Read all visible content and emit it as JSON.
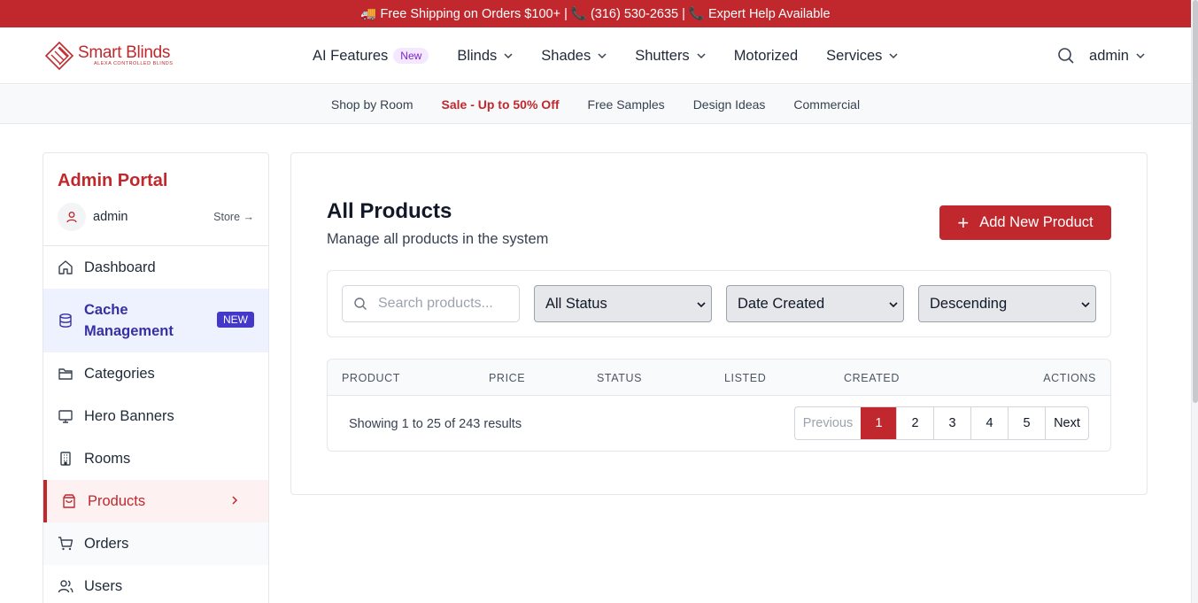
{
  "promo": {
    "text": "🚚 Free Shipping on Orders $100+ | 📞 (316) 530-2635 | 📞 Expert Help Available"
  },
  "logo": {
    "title": "Smart Blinds",
    "subtitle": "ALEXA CONTROLLED BLINDS"
  },
  "nav": {
    "items": [
      {
        "label": "AI Features",
        "badge": "New"
      },
      {
        "label": "Blinds"
      },
      {
        "label": "Shades"
      },
      {
        "label": "Shutters"
      },
      {
        "label": "Motorized"
      },
      {
        "label": "Services"
      }
    ],
    "user": "admin"
  },
  "subnav": [
    "Shop by Room",
    "Sale - Up to 50% Off",
    "Free Samples",
    "Design Ideas",
    "Commercial"
  ],
  "sidebar": {
    "title": "Admin Portal",
    "user": "admin",
    "store_link": "Store →",
    "items": [
      {
        "label": "Dashboard",
        "icon": "home-icon"
      },
      {
        "label": "Cache Management",
        "icon": "database-icon",
        "badge": "NEW"
      },
      {
        "label": "Categories",
        "icon": "folder-icon"
      },
      {
        "label": "Hero Banners",
        "icon": "monitor-icon"
      },
      {
        "label": "Rooms",
        "icon": "building-icon"
      },
      {
        "label": "Products",
        "icon": "shopping-bag-icon",
        "active": true
      },
      {
        "label": "Orders",
        "icon": "cart-icon"
      },
      {
        "label": "Users",
        "icon": "users-icon"
      }
    ]
  },
  "main": {
    "title": "All Products",
    "subtitle": "Manage all products in the system",
    "add_button": "Add New Product",
    "search_placeholder": "Search products...",
    "filters": {
      "status": "All Status",
      "sort_by": "Date Created",
      "order": "Descending"
    },
    "columns": [
      "PRODUCT",
      "PRICE",
      "STATUS",
      "LISTED",
      "CREATED",
      "ACTIONS"
    ],
    "showing": "Showing 1 to 25 of 243 results",
    "pagination": {
      "previous": "Previous",
      "pages": [
        "1",
        "2",
        "3",
        "4",
        "5"
      ],
      "current": "1",
      "next": "Next"
    }
  },
  "colors": {
    "brand": "#c0282d",
    "accent_indigo": "#4338ca",
    "ai_badge": "#7e22ce"
  }
}
